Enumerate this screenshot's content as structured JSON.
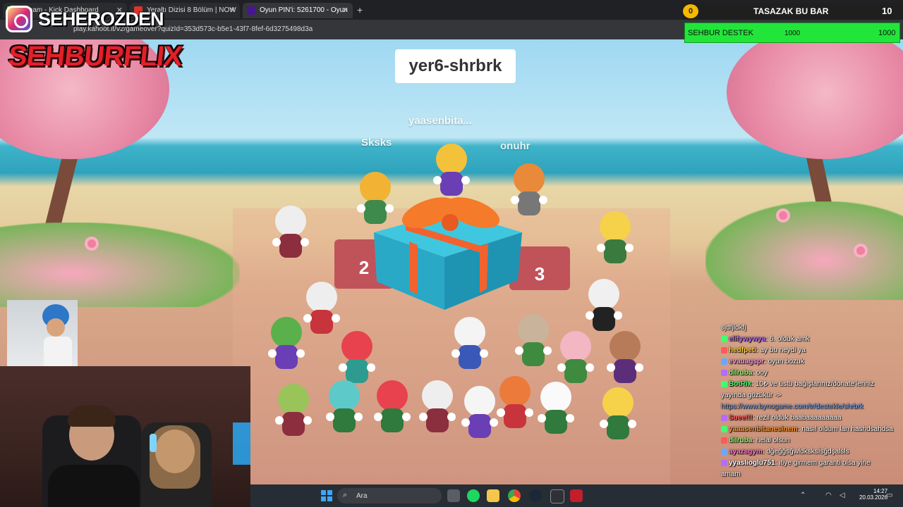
{
  "browser": {
    "tabs": [
      {
        "label": "Stream - Kick Dashboard"
      },
      {
        "label": "Yeraltı Dizisi 8 Bölüm | NOW"
      },
      {
        "label": "Oyun PIN'i: 5261700 - Oyun"
      }
    ],
    "new_tab": "+",
    "url": "play.kahoot.it/v2/gameover?quizId=353d573c-b5e1-43f7-8fef-6d3275498d3a"
  },
  "overlay": {
    "instagram_handle": "SEHEROZDEN",
    "brand": "SEHBURFLIX",
    "bar": {
      "coin": "0",
      "title": "TASAZAK BU BAR",
      "count": "10"
    },
    "destek": {
      "label": "SEHBUR DESTEK",
      "value_left": "1000",
      "value_right": "1000"
    }
  },
  "game": {
    "nickname": "yer6-shrbrk",
    "player_names": [
      "yaasenbita...",
      "Sksks",
      "onuhr"
    ],
    "podium": {
      "second": "2",
      "third": "3"
    }
  },
  "chat": [
    {
      "user": "",
      "text": "sjdfjldkfj",
      "user_color": "#ffffff"
    },
    {
      "user": "elifywywya",
      "text": ": 6. olduk amk",
      "user_color": "#b46cff"
    },
    {
      "user": "hedfpeti",
      "text": ": ay bu neydi ya",
      "user_color": "#ffd23f"
    },
    {
      "user": "evauagspr",
      "text": ": oyun bozuk",
      "user_color": "#ff9de0"
    },
    {
      "user": "dilruba",
      "text": ": ooy",
      "user_color": "#9aff7a"
    },
    {
      "user": "BotRix",
      "text": ": 10₺ ve üstü bağışlarınız/donate'leriniz",
      "user_color": "#3dff6f"
    },
    {
      "user": "",
      "text": "yayında gözükür ->",
      "user_color": "#ffffff"
    },
    {
      "user": "",
      "text": "https://www.bynogame.com/tr/destekle/shrbrk",
      "user_color": "#6aa8ff"
    },
    {
      "user": "Suee!!!",
      "text": ": rezil olduk baabaaaaaaaaa",
      "user_color": "#ff5a5a"
    },
    {
      "user": "yaaasenbitanesinem",
      "text": ": nasıl oldum lan hashdsahdsa",
      "user_color": "#ff9a3d"
    },
    {
      "user": "dilruba",
      "text": ": helal olsun",
      "user_color": "#9aff7a"
    },
    {
      "user": "ayazsgym",
      "text": ": dğeğğsğwldksksİsğdşalsls",
      "user_color": "#ff7ad0"
    },
    {
      "user": "yyaslioglu751",
      "text": ": itiye girmem garanti olsa yine",
      "user_color": "#ffffff"
    },
    {
      "user": "",
      "text": "amam",
      "user_color": "#ffffff"
    }
  ],
  "taskbar": {
    "search_label": "Ara",
    "time": "14:27",
    "date": "20.03.2026"
  },
  "colors": {
    "destek_green": "#22e53a",
    "brand_red": "#e32029",
    "tab_active": "#35363a"
  }
}
